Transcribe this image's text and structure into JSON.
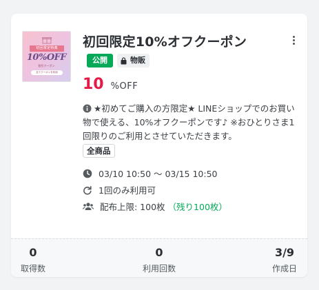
{
  "coupon": {
    "title": "初回限定10%オフクーポン",
    "status_badge": "公開",
    "type_badge": "物販",
    "discount_value": "10",
    "discount_unit": "%OFF",
    "description": "★初めてご購入の方限定★ LINEショップでのお買い物で使える、10%オフクーポンです♪ ※おひとりさま1回限りのご利用とさせていただきます。",
    "scope": "全商品",
    "period": "03/10 10:50 〜 03/15 10:50",
    "usage_limit": "1回のみ利用可",
    "distribution_limit": "配布上限: 100枚",
    "remaining": "（残り100枚）",
    "thumbnail": {
      "band_text": "初回限定特典",
      "headline": "10%OFF",
      "subline": "割引クーポン",
      "pill": "全てクーポンを利用"
    }
  },
  "stats": [
    {
      "value": "0",
      "label": "取得数"
    },
    {
      "value": "0",
      "label": "利用回数"
    },
    {
      "value": "3/9",
      "label": "作成日"
    }
  ],
  "colors": {
    "accent_green": "#06a957",
    "discount_red": "#e31b46"
  },
  "icons": [
    "more-vertical-icon",
    "bag-icon",
    "info-icon",
    "clock-icon",
    "redo-icon",
    "users-icon",
    "gift-icon"
  ]
}
